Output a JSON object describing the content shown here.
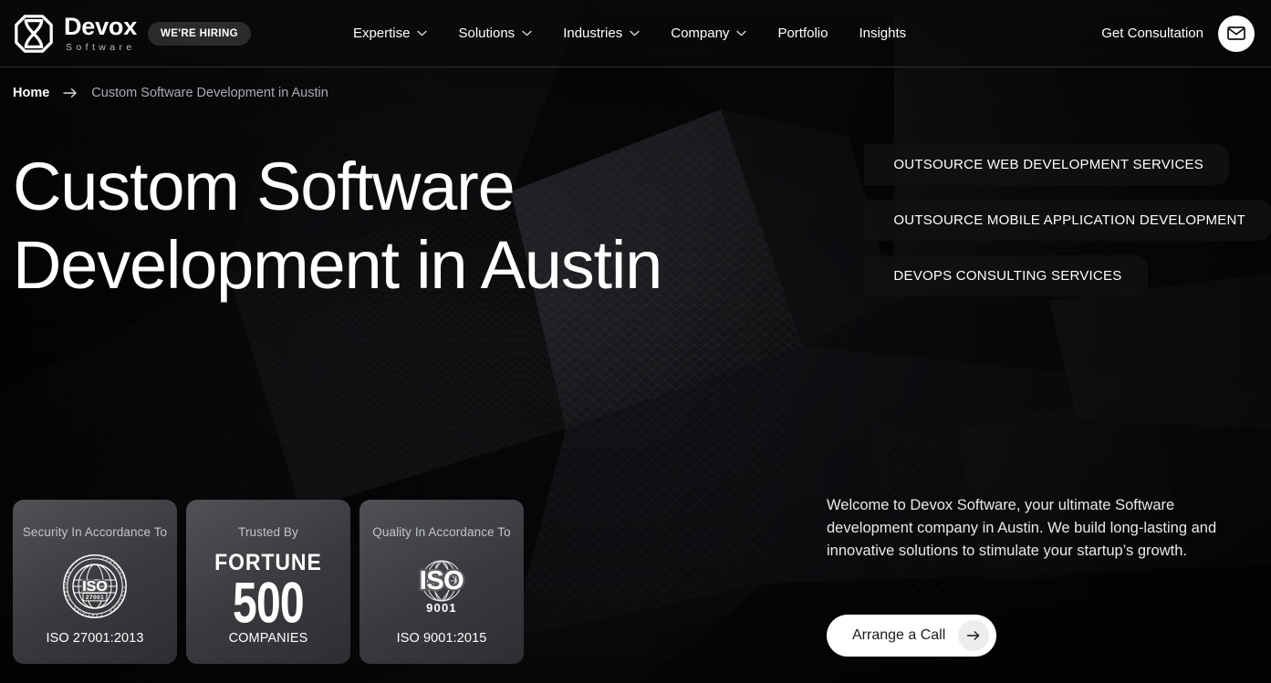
{
  "header": {
    "brand_name": "Devox",
    "brand_sub": "Software",
    "logo_icon": "devox-hexagon-logo-icon",
    "hiring_badge": "WE'RE HIRING",
    "nav": [
      {
        "label": "Expertise",
        "has_dropdown": true
      },
      {
        "label": "Solutions",
        "has_dropdown": true
      },
      {
        "label": "Industries",
        "has_dropdown": true
      },
      {
        "label": "Company",
        "has_dropdown": true
      },
      {
        "label": "Portfolio",
        "has_dropdown": false
      },
      {
        "label": "Insights",
        "has_dropdown": false
      }
    ],
    "consultation_label": "Get Consultation",
    "mail_icon": "envelope-icon"
  },
  "breadcrumb": {
    "home": "Home",
    "arrow_icon": "arrow-right-icon",
    "current": "Custom Software Development in Austin"
  },
  "hero": {
    "title_line1": "Custom Software",
    "title_line2": "Development in Austin"
  },
  "service_pills": [
    "Outsource Web Development Services",
    "Outsource Mobile Application Development",
    "DevOps Consulting Services"
  ],
  "badge_cards": [
    {
      "top": "Security In Accordance To",
      "bottom": "ISO 27001:2013",
      "art": "iso-27001-seal-icon",
      "seal_ring_text": "CERTIFIED · CERTIFIED · CERTIFIED · CERTIFIED",
      "seal_iso": "ISO",
      "seal_number": "27001"
    },
    {
      "top": "Trusted By",
      "bottom": "COMPANIES",
      "art": "fortune-500-logo-icon",
      "fortune_word": "FORTUNE",
      "fortune_number": "500"
    },
    {
      "top": "Quality In Accordance To",
      "bottom": "ISO 9001:2015",
      "art": "iso-9001-globe-icon",
      "seal_iso": "ISO",
      "seal_number": "9001"
    }
  ],
  "intro": {
    "text": "Welcome to Devox Software, your ultimate Software development company in Austin. We build long-lasting and innovative solutions to stimulate your startup’s growth."
  },
  "cta": {
    "label": "Arrange a Call",
    "arrow_icon": "arrow-right-icon"
  },
  "colors": {
    "page_bg": "#08080a",
    "text_primary": "#ffffff",
    "text_muted": "#a8abb1",
    "card_bg": "#3c3e42",
    "cta_bg": "#ffffff",
    "cta_text": "#1a1b1d"
  }
}
